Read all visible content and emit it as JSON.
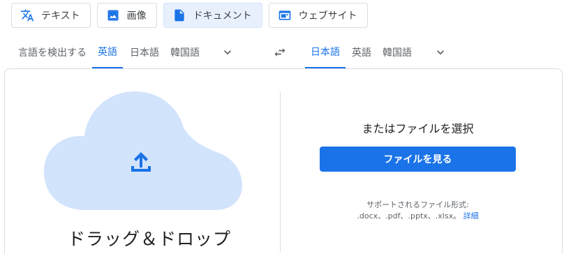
{
  "modes": [
    {
      "label": "テキスト",
      "icon": "translate-icon",
      "active": false
    },
    {
      "label": "画像",
      "icon": "image-icon",
      "active": false
    },
    {
      "label": "ドキュメント",
      "icon": "document-icon",
      "active": true
    },
    {
      "label": "ウェブサイト",
      "icon": "website-icon",
      "active": false
    }
  ],
  "source_langs": [
    "言語を検出する",
    "英語",
    "日本語",
    "韓国語"
  ],
  "source_active": "英語",
  "target_langs": [
    "日本語",
    "英語",
    "韓国語"
  ],
  "target_active": "日本語",
  "upload": {
    "drop_text": "ドラッグ＆ドロップ",
    "choose_title": "またはファイルを選択",
    "browse_button": "ファイルを見る",
    "supported_label": "サポートされるファイル形式:",
    "supported_formats": ".docx、.pdf、.pptx、.xlsx。",
    "details_link": "詳細"
  },
  "colors": {
    "accent": "#1a73e8",
    "cloud": "#d2e3fc",
    "active_tab_bg": "#e8f0fe"
  }
}
